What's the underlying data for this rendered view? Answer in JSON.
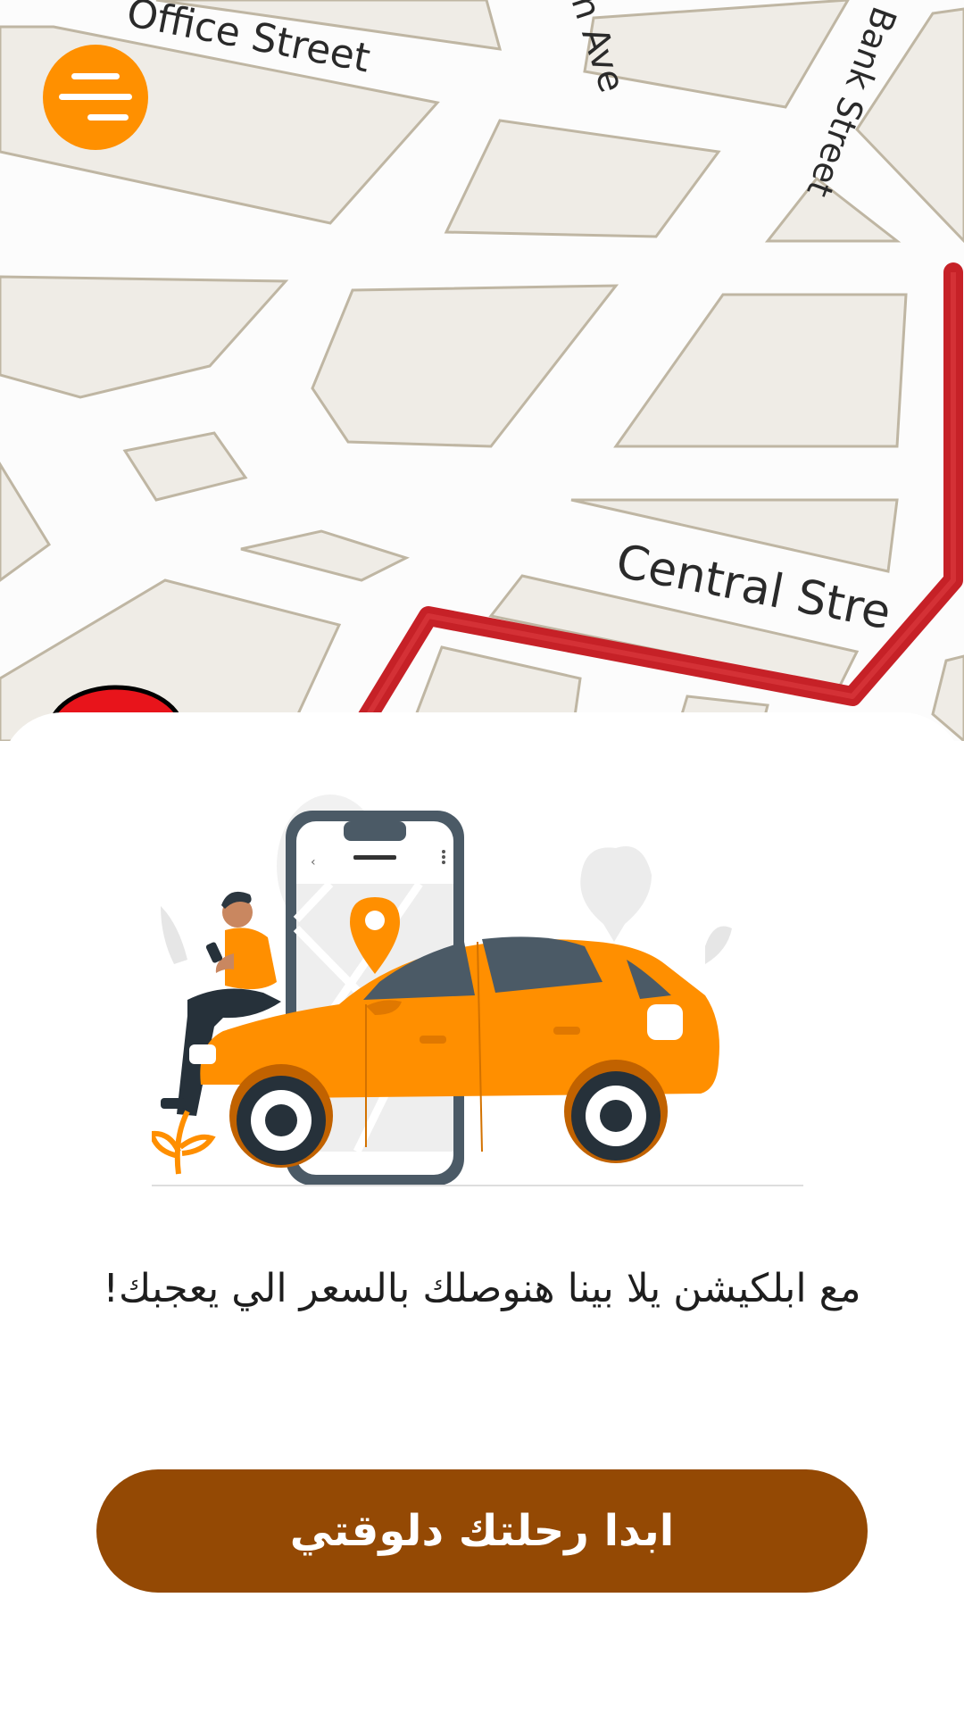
{
  "map": {
    "streets": [
      {
        "name": "Office Street"
      },
      {
        "name": "Main Ave",
        "visible_text": "n Ave"
      },
      {
        "name": "Bank Street"
      },
      {
        "name": "Central Street",
        "visible_text": "Central Stre"
      }
    ],
    "route_color": "#c62127",
    "block_fill": "#efece6",
    "block_stroke": "#bfb6a3"
  },
  "menu_button": {
    "icon": "hamburger-menu-icon",
    "color": "#ff9000"
  },
  "illustration": {
    "icon": "car-booking-illustration",
    "car_color": "#ff8f00"
  },
  "tagline": "مع ابلكيشن يلا بينا هنوصلك بالسعر الي يعجبك!",
  "cta": {
    "label": "ابدا رحلتك دلوقتي",
    "color": "#944904"
  }
}
